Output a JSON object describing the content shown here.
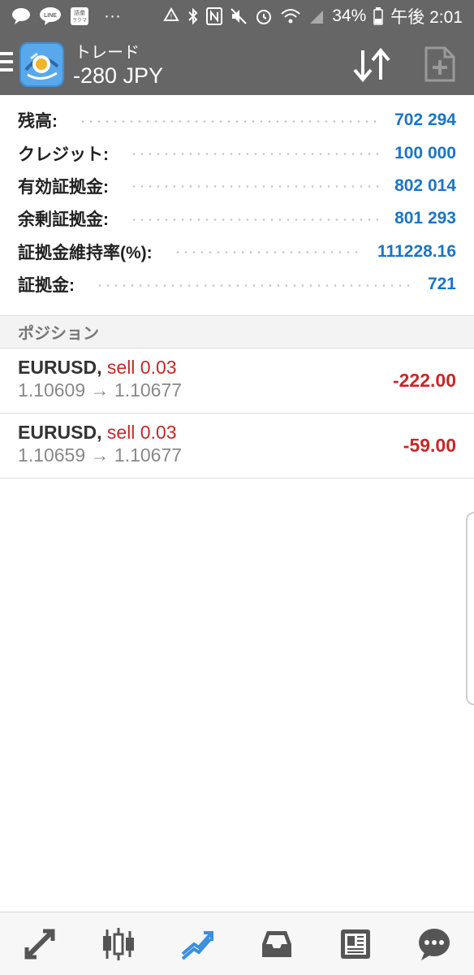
{
  "status_bar": {
    "line_badge": "LINE",
    "app_badge_top": "語彙",
    "app_badge_bottom": "ラクマ",
    "more": "···",
    "battery": "34%",
    "time": "午後 2:01"
  },
  "app_bar": {
    "title": "トレード",
    "profit": "-280 JPY",
    "icons": [
      "menu-icon",
      "metatrader-logo",
      "sort-icon",
      "new-order-icon"
    ]
  },
  "account_summary": [
    {
      "label": "残高:",
      "value": "702 294"
    },
    {
      "label": "クレジット:",
      "value": "100 000"
    },
    {
      "label": "有効証拠金:",
      "value": "802 014"
    },
    {
      "label": "余剰証拠金:",
      "value": "801 293"
    },
    {
      "label": "証拠金維持率(%):",
      "value": "111228.16"
    },
    {
      "label": "証拠金:",
      "value": "721"
    }
  ],
  "positions_header": "ポジション",
  "positions": [
    {
      "symbol": "EURUSD,",
      "side": "sell 0.03",
      "prices": "1.10609 → 1.10677",
      "profit": "-222.00"
    },
    {
      "symbol": "EURUSD,",
      "side": "sell 0.03",
      "prices": "1.10659 → 1.10677",
      "profit": "-59.00"
    }
  ],
  "bottom_nav": [
    {
      "name": "quotes-icon",
      "active": false
    },
    {
      "name": "chart-icon",
      "active": false
    },
    {
      "name": "trade-icon",
      "active": true
    },
    {
      "name": "history-icon",
      "active": false
    },
    {
      "name": "news-icon",
      "active": false
    },
    {
      "name": "chat-icon",
      "active": false
    }
  ],
  "colors": {
    "header": "#666666",
    "value_blue": "#1a75c7",
    "loss_red": "#c62828",
    "active_nav": "#3b8fe0",
    "inactive_nav": "#555555"
  }
}
